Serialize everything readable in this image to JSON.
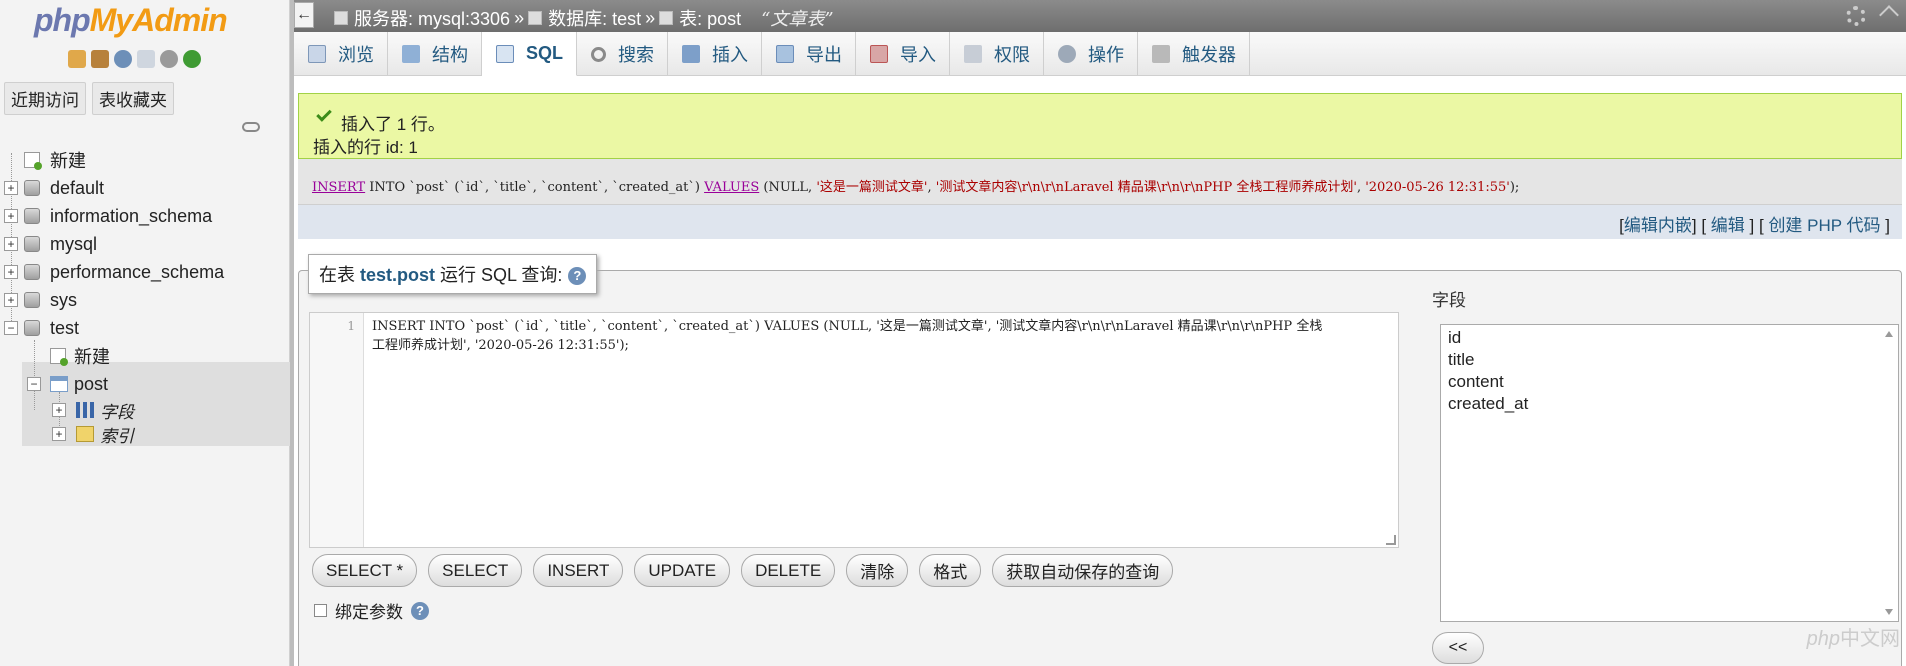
{
  "logo": {
    "php": "php",
    "myadmin": "MyAdmin"
  },
  "nav": {
    "tabs": [
      "近期访问",
      "表收藏夹"
    ],
    "tree": {
      "new_label": "新建",
      "databases": [
        "default",
        "information_schema",
        "mysql",
        "performance_schema",
        "sys",
        "test"
      ],
      "test_children": {
        "new_label": "新建",
        "table": "post",
        "table_children": [
          "字段",
          "索引"
        ]
      }
    }
  },
  "breadcrumb": {
    "server": "服务器: mysql:3306",
    "sep1": "»",
    "database": "数据库: test",
    "sep2": "»",
    "table": "表: post",
    "comment": "“文章表”"
  },
  "tabs": [
    {
      "label": "浏览",
      "icon": "browse-icon"
    },
    {
      "label": "结构",
      "icon": "structure-icon"
    },
    {
      "label": "SQL",
      "icon": "sql-icon",
      "active": true
    },
    {
      "label": "搜索",
      "icon": "search-icon"
    },
    {
      "label": "插入",
      "icon": "insert-icon"
    },
    {
      "label": "导出",
      "icon": "export-icon"
    },
    {
      "label": "导入",
      "icon": "import-icon"
    },
    {
      "label": "权限",
      "icon": "privileges-icon"
    },
    {
      "label": "操作",
      "icon": "operations-icon"
    },
    {
      "label": "触发器",
      "icon": "triggers-icon"
    }
  ],
  "message": {
    "line1": "插入了 1 行。",
    "line2": "插入的行 id: 1"
  },
  "sql_preview": {
    "kw_insert": "INSERT",
    "part1": " INTO `post` (`id`, `title`, `content`, `created_at`) ",
    "kw_values": "VALUES",
    "part2": " (NULL, ",
    "s1": "'这是一篇测试文章'",
    "c1": ", ",
    "s2": "'测试文章内容\\r\\n\\r\\nLaravel 精品课\\r\\n\\r\\nPHP 全栈工程师养成计划'",
    "c2": ", ",
    "s3": "'2020-05-26 12:31:55'",
    "end": ");"
  },
  "sql_actions": {
    "open1": "[",
    "edit_inline": "编辑内嵌",
    "close1": "] [",
    "edit": "编辑",
    "close2": "] [",
    "create_php": "创建 PHP 代码",
    "close3": "]"
  },
  "query_box": {
    "legend_prefix": "在表 ",
    "legend_table": "test.post",
    "legend_suffix": " 运行 SQL 查询:",
    "line_number": "1",
    "code_line1": "INSERT INTO `post` (`id`, `title`, `content`, `created_at`) VALUES (NULL, '这是一篇测试文章', '测试文章内容\\r\\n\\r\\nLaravel 精品课\\r\\n\\r\\nPHP 全栈",
    "code_line2": "工程师养成计划', '2020-05-26 12:31:55');"
  },
  "buttons": [
    "SELECT *",
    "SELECT",
    "INSERT",
    "UPDATE",
    "DELETE",
    "清除",
    "格式",
    "获取自动保存的查询"
  ],
  "bind_params_label": "绑定参数",
  "fields": {
    "title": "字段",
    "items": [
      "id",
      "title",
      "content",
      "created_at"
    ],
    "insert_button": "<<"
  },
  "watermark": {
    "php": "php",
    "text": "中文网"
  },
  "colors": {
    "accent": "#235a81",
    "success_bg": "#ebf8a4",
    "topbar": "#7a7a7a"
  }
}
